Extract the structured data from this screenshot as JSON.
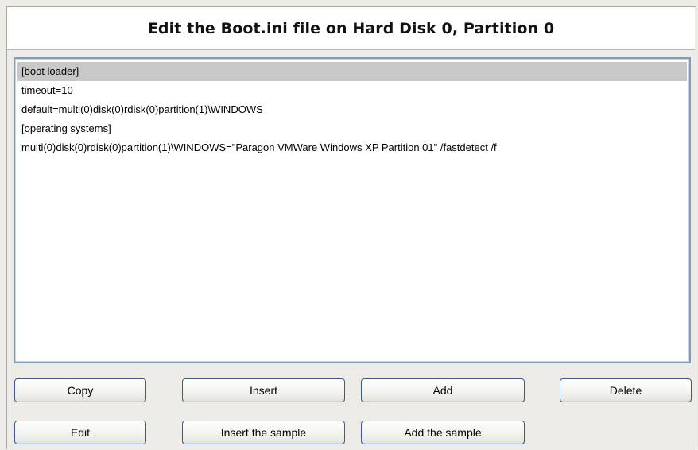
{
  "dialog": {
    "title": "Edit the Boot.ini file on Hard Disk 0, Partition 0"
  },
  "editor": {
    "lines": [
      "[boot loader]",
      "timeout=10",
      "default=multi(0)disk(0)rdisk(0)partition(1)\\WINDOWS",
      "[operating systems]",
      "multi(0)disk(0)rdisk(0)partition(1)\\WINDOWS=\"Paragon VMWare Windows XP Partition 01\" /fastdetect /f"
    ],
    "selected_index": 0
  },
  "buttons": {
    "copy": "Copy",
    "insert": "Insert",
    "add": "Add",
    "delete": "Delete",
    "edit": "Edit",
    "insert_sample": "Insert the sample",
    "add_sample": "Add the sample"
  }
}
